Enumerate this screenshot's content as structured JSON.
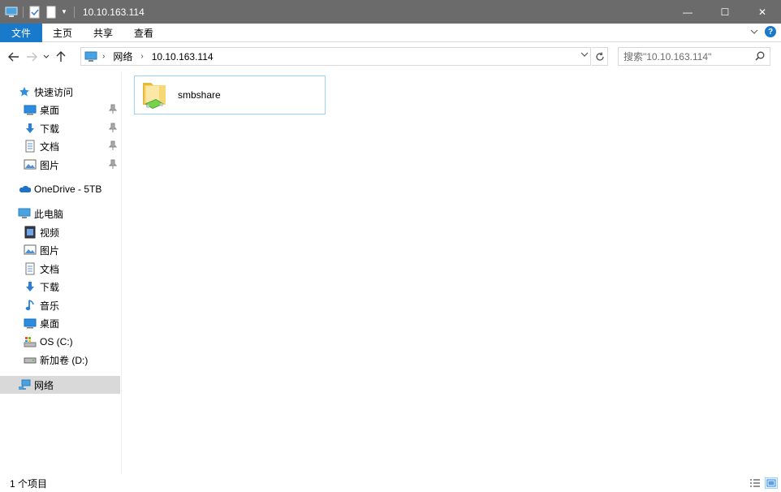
{
  "window": {
    "title": "10.10.163.114",
    "controls": {
      "minimize": "—",
      "maximize": "☐",
      "close": "✕"
    }
  },
  "ribbon": {
    "tabs": [
      "文件",
      "主页",
      "共享",
      "查看"
    ],
    "expand_icon": "chevron-down-icon",
    "help_label": "?"
  },
  "navigation": {
    "breadcrumb": [
      "网络",
      "10.10.163.114"
    ],
    "search_placeholder": "搜索\"10.10.163.114\""
  },
  "sidebar": {
    "quick_access": {
      "label": "快速访问",
      "items": [
        "桌面",
        "下载",
        "文档",
        "图片"
      ]
    },
    "onedrive": {
      "label": "OneDrive - 5TB"
    },
    "this_pc": {
      "label": "此电脑",
      "items": [
        "视频",
        "图片",
        "文档",
        "下载",
        "音乐",
        "桌面",
        "OS (C:)",
        "新加卷 (D:)"
      ]
    },
    "network": {
      "label": "网络"
    }
  },
  "content": {
    "items": [
      {
        "name": "smbshare",
        "icon": "shared-folder-icon"
      }
    ]
  },
  "status": {
    "item_count": "1 个项目"
  },
  "colors": {
    "accent": "#1979ca",
    "titlebar": "#6b6b6b",
    "selection": "#d9d9d9",
    "tile_border": "#99d1ff"
  }
}
